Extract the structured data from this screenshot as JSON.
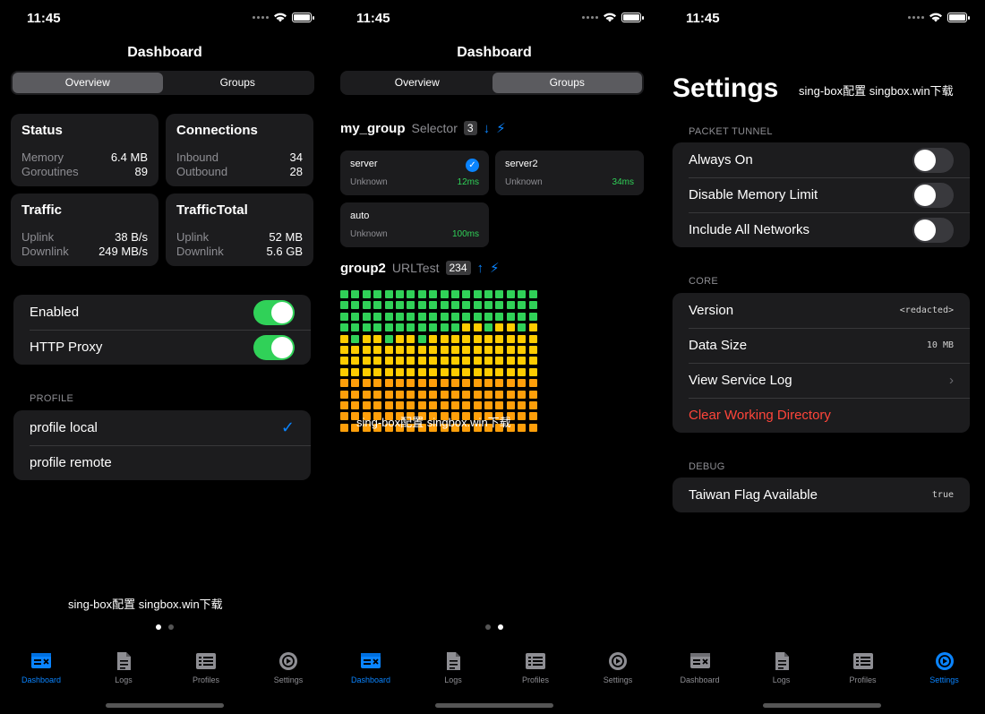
{
  "status_time": "11:45",
  "colors": {
    "accent": "#0a84ff",
    "green": "#30d158",
    "red": "#ff453a",
    "yellow": "#ffcc00",
    "orange": "#ff9f0a"
  },
  "tabs": [
    {
      "label": "Dashboard",
      "icon": "dashboard-icon"
    },
    {
      "label": "Logs",
      "icon": "logs-icon"
    },
    {
      "label": "Profiles",
      "icon": "profiles-icon"
    },
    {
      "label": "Settings",
      "icon": "settings-icon"
    }
  ],
  "dashboard": {
    "title": "Dashboard",
    "segments": [
      "Overview",
      "Groups"
    ],
    "status": {
      "title": "Status",
      "rows": [
        {
          "k": "Memory",
          "v": "6.4 MB"
        },
        {
          "k": "Goroutines",
          "v": "89"
        }
      ]
    },
    "connections": {
      "title": "Connections",
      "rows": [
        {
          "k": "Inbound",
          "v": "34"
        },
        {
          "k": "Outbound",
          "v": "28"
        }
      ]
    },
    "traffic": {
      "title": "Traffic",
      "rows": [
        {
          "k": "Uplink",
          "v": "38 B/s"
        },
        {
          "k": "Downlink",
          "v": "249 MB/s"
        }
      ]
    },
    "traffic_total": {
      "title": "TrafficTotal",
      "rows": [
        {
          "k": "Uplink",
          "v": "52 MB"
        },
        {
          "k": "Downlink",
          "v": "5.6 GB"
        }
      ]
    },
    "toggles": [
      {
        "label": "Enabled",
        "on": true
      },
      {
        "label": "HTTP Proxy",
        "on": true
      }
    ],
    "profile_section": "PROFILE",
    "profiles": [
      {
        "label": "profile local",
        "selected": true
      },
      {
        "label": "profile remote",
        "selected": false
      }
    ],
    "watermark": "sing-box配置 singbox.win下载"
  },
  "groups": {
    "title": "Dashboard",
    "group1": {
      "name": "my_group",
      "type": "Selector",
      "count": "3"
    },
    "nodes": [
      {
        "name": "server",
        "type": "Unknown",
        "latency": "12ms",
        "selected": true
      },
      {
        "name": "server2",
        "type": "Unknown",
        "latency": "34ms",
        "selected": false
      },
      {
        "name": "auto",
        "type": "Unknown",
        "latency": "100ms",
        "selected": false
      }
    ],
    "group2": {
      "name": "group2",
      "type": "URLTest",
      "count": "234"
    },
    "grid_rows": [
      {
        "count": 16,
        "status": "green"
      },
      {
        "count": 16,
        "status": "green"
      },
      {
        "count": 16,
        "status": "green"
      },
      {
        "count": 16,
        "status": "green"
      },
      {
        "count": 16,
        "status": "mixed"
      },
      {
        "count": 16,
        "status": "yellow"
      },
      {
        "count": 16,
        "status": "yellow"
      },
      {
        "count": 16,
        "status": "yellow"
      },
      {
        "count": 16,
        "status": "yellow"
      },
      {
        "count": 16,
        "status": "orange"
      },
      {
        "count": 16,
        "status": "orange"
      },
      {
        "count": 16,
        "status": "orange"
      },
      {
        "count": 16,
        "status": "orange"
      },
      {
        "count": 16,
        "status": "orange"
      },
      {
        "count": 10,
        "status": "orange"
      }
    ],
    "watermark": "sing-box配置 singbox.win下载"
  },
  "settings": {
    "title": "Settings",
    "watermark": "sing-box配置 singbox.win下载",
    "packet_tunnel_section": "PACKET TUNNEL",
    "packet_tunnel": [
      {
        "label": "Always On",
        "on": false
      },
      {
        "label": "Disable Memory Limit",
        "on": false
      },
      {
        "label": "Include All Networks",
        "on": false
      }
    ],
    "core_section": "CORE",
    "core": {
      "version_label": "Version",
      "version_value": "<redacted>",
      "data_size_label": "Data Size",
      "data_size_value": "10 MB",
      "log_label": "View Service Log",
      "clear_label": "Clear Working Directory"
    },
    "debug_section": "DEBUG",
    "debug": {
      "label": "Taiwan Flag Available",
      "value": "true"
    }
  }
}
